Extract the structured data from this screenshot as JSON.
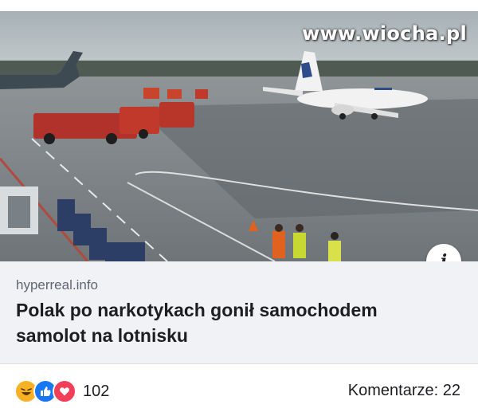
{
  "watermark": "www.wiocha.pl",
  "info_button": {
    "label": "i"
  },
  "link_preview": {
    "domain": "hyperreal.info",
    "title": "Polak po narkotykach gonił samochodem samolot na lotnisku"
  },
  "reactions": {
    "icons": [
      "haha-icon",
      "like-icon",
      "love-icon"
    ],
    "count": "102"
  },
  "comments": {
    "label": "Komentarze: 22"
  },
  "colors": {
    "like": "#1877f2",
    "love": "#f33e58",
    "haha": "#f7b125",
    "fire_truck": "#c0392b",
    "tarmac": "#8f9597"
  }
}
